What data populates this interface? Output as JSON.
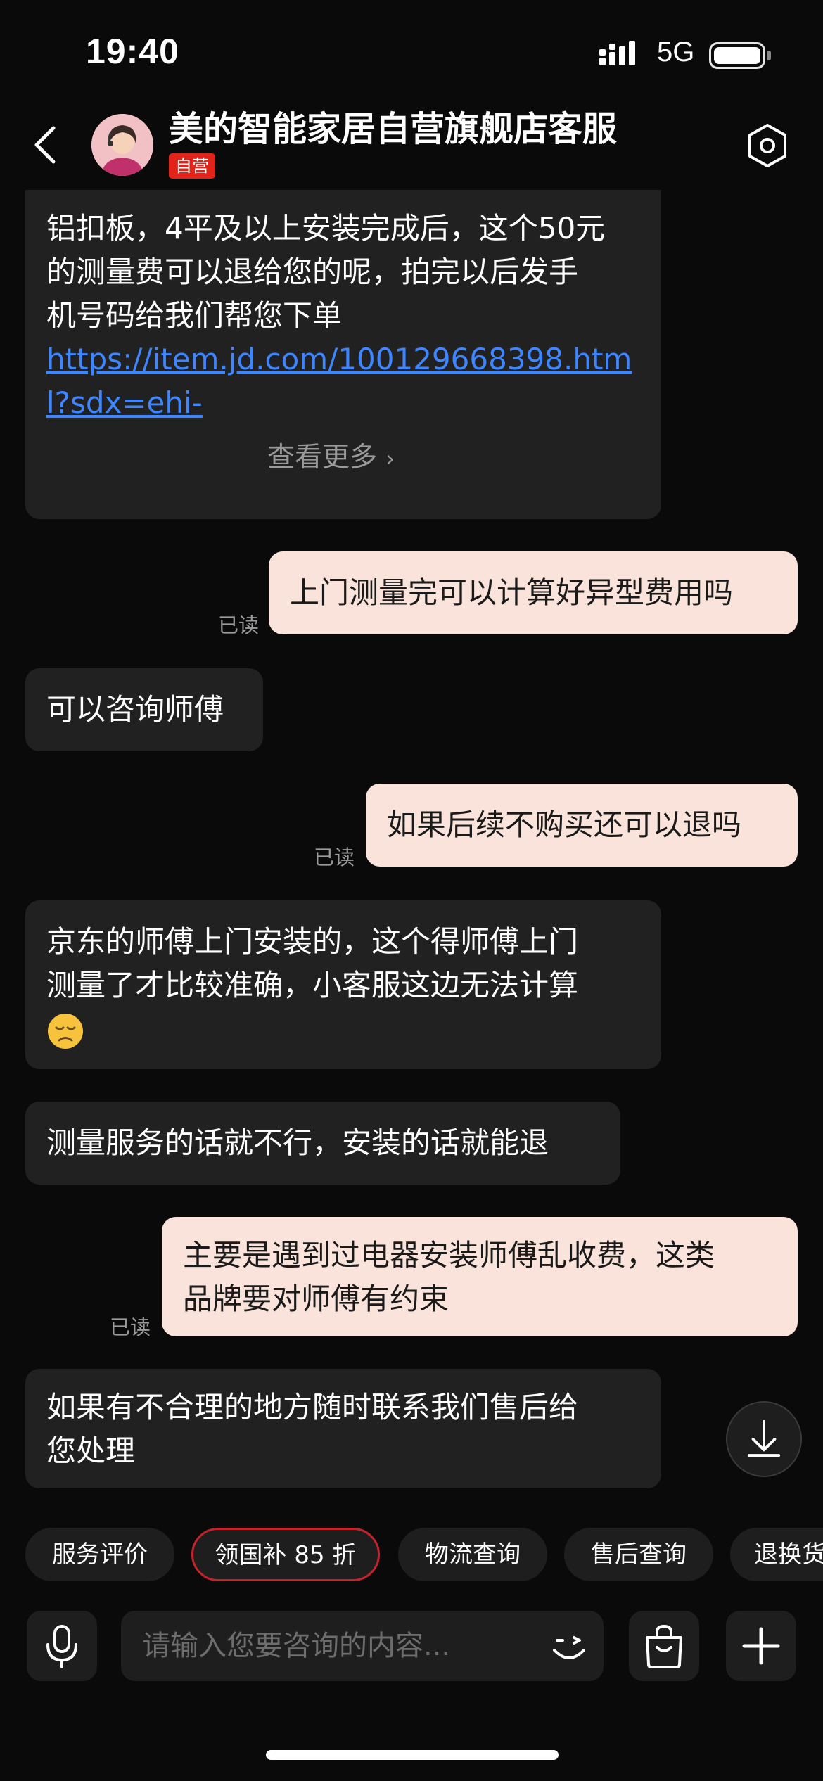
{
  "status_bar": {
    "time": "19:40",
    "network": "5G",
    "battery_level": 0.85
  },
  "header": {
    "shop_name": "美的智能家居自营旗舰店客服",
    "badge": "自营"
  },
  "messages": [
    {
      "from": "service",
      "lines": [
        "铝扣板，4平及以上安装完成后，这个50元",
        "的测量费可以退给您的呢，拍完以后发手",
        "机号码给我们帮您下单"
      ],
      "link": "https://item.jd.com/100129668398.html?sdx=ehi-",
      "more": "查看更多"
    },
    {
      "from": "user",
      "text": "上门测量完可以计算好异型费用吗",
      "status": "已读"
    },
    {
      "from": "service",
      "text": "可以咨询师傅"
    },
    {
      "from": "user",
      "text": "如果后续不购买还可以退吗",
      "status": "已读"
    },
    {
      "from": "service",
      "lines": [
        "京东的师傅上门安装的，这个得师傅上门",
        "测量了才比较准确，小客服这边无法计算"
      ],
      "emoji": "disappointed-face"
    },
    {
      "from": "service",
      "text": "测量服务的话就不行，安装的话就能退"
    },
    {
      "from": "user",
      "lines": [
        "主要是遇到过电器安装师傅乱收费，这类",
        "品牌要对师傅有约束"
      ],
      "status": "已读"
    },
    {
      "from": "service",
      "lines": [
        "如果有不合理的地方随时联系我们售后给",
        "您处理"
      ]
    }
  ],
  "quick_actions": [
    "服务评价",
    "领国补 85 折",
    "物流查询",
    "售后查询",
    "退换货"
  ],
  "input": {
    "placeholder": "请输入您要咨询的内容..."
  },
  "colors": {
    "user_bubble": "#f9e3db",
    "service_bubble": "#212121",
    "link": "#3d86ff",
    "badge": "#e2231a",
    "hot_chip_border": "#c4232b"
  }
}
